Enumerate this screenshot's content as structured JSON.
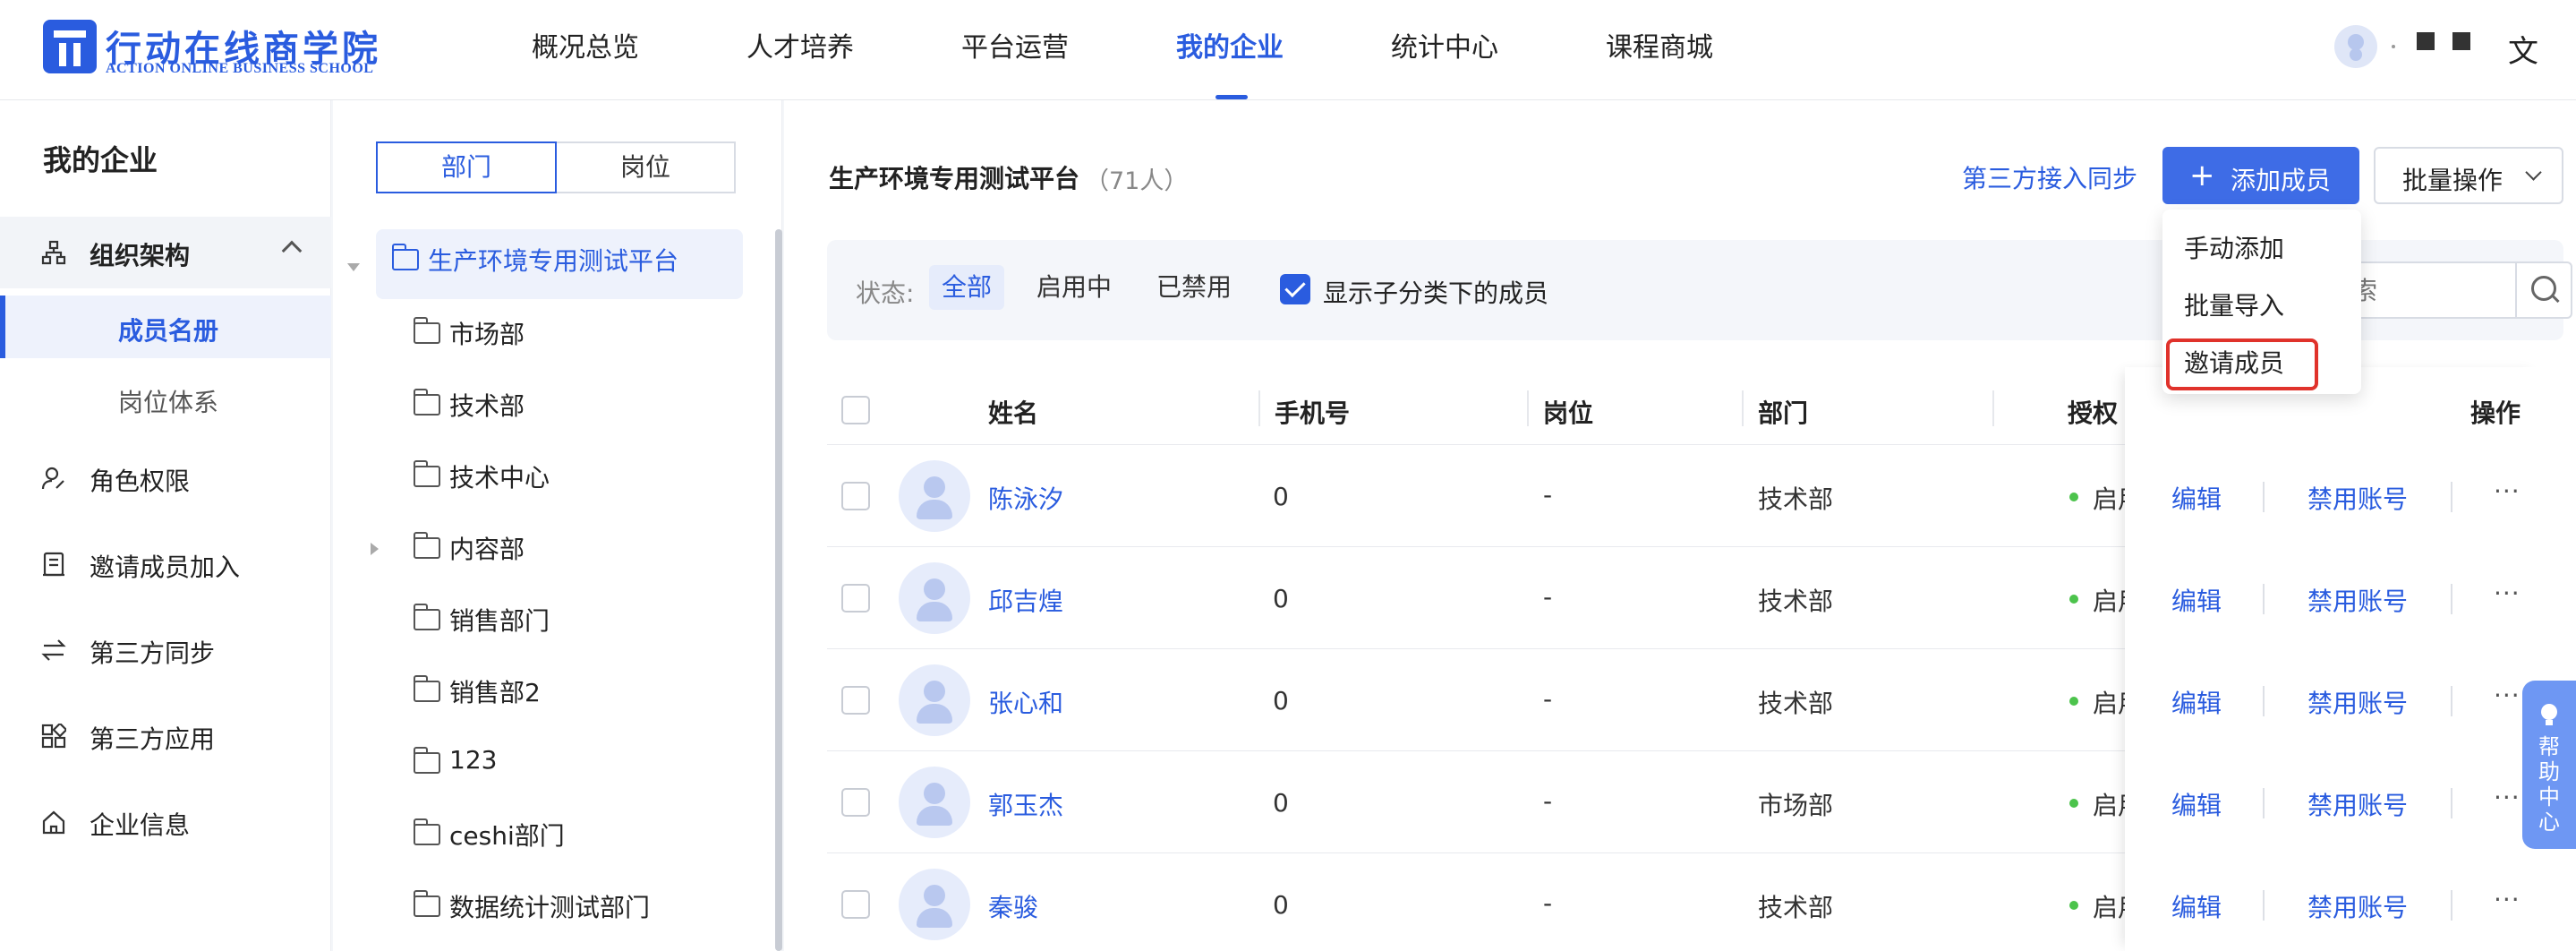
{
  "brand": {
    "name_cn": "行动在线商学院",
    "name_en": "ACTION ONLINE BUSINESS SCHOOL",
    "color": "#2a5cdf"
  },
  "nav": {
    "items": [
      "概况总览",
      "人才培养",
      "平台运营",
      "我的企业",
      "统计中心",
      "课程商城"
    ],
    "active": "我的企业"
  },
  "header": {
    "user_dot": ".",
    "lang_icon": "translate-icon"
  },
  "sidebar": {
    "title": "我的企业",
    "group": {
      "label": "组织架构",
      "expanded": true
    },
    "sub_items": [
      "成员名册",
      "岗位体系"
    ],
    "active_sub": "成员名册",
    "items": [
      "角色权限",
      "邀请成员加入",
      "第三方同步",
      "第三方应用",
      "企业信息"
    ]
  },
  "tree": {
    "tabs": [
      "部门",
      "岗位"
    ],
    "active_tab": "部门",
    "root": "生产环境专用测试平台",
    "children": [
      "市场部",
      "技术部",
      "技术中心",
      "内容部",
      "销售部门",
      "销售部2",
      "123",
      "ceshi部门",
      "数据统计测试部门"
    ]
  },
  "main": {
    "org_title": "生产环境专用测试平台",
    "org_count": "（71人）",
    "sync_link": "第三方接入同步",
    "add_button": "添加成员",
    "batch_button": "批量操作",
    "dropdown": [
      "手动添加",
      "批量导入",
      "邀请成员"
    ],
    "dropdown_highlight": "邀请成员",
    "filter": {
      "label": "状态:",
      "options": [
        "全部",
        "启用中",
        "已禁用"
      ],
      "active": "全部",
      "show_sub_label": "显示子分类下的成员",
      "show_sub_checked": true,
      "search_placeholder": "搜索"
    },
    "table": {
      "headers": [
        "姓名",
        "手机号",
        "岗位",
        "部门",
        "授权",
        "操作"
      ],
      "rows": [
        {
          "name": "陈泳汐",
          "phone": "0",
          "position": "-",
          "dept": "技术部",
          "status": "启用"
        },
        {
          "name": "邱吉煌",
          "phone": "0",
          "position": "-",
          "dept": "技术部",
          "status": "启用"
        },
        {
          "name": "张心和",
          "phone": "0",
          "position": "-",
          "dept": "技术部",
          "status": "启用"
        },
        {
          "name": "郭玉杰",
          "phone": "0",
          "position": "-",
          "dept": "市场部",
          "status": "启用"
        },
        {
          "name": "秦骏",
          "phone": "0",
          "position": "-",
          "dept": "技术部",
          "status": "启用"
        }
      ],
      "actions": {
        "edit": "编辑",
        "disable": "禁用账号",
        "more": "···"
      }
    }
  },
  "help": {
    "label": "帮助中心"
  }
}
